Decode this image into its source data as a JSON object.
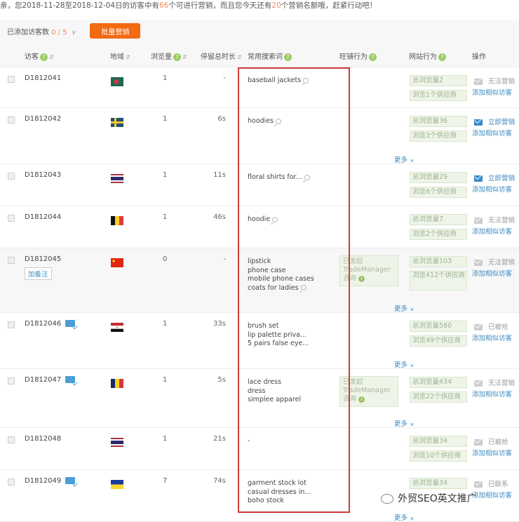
{
  "notice": {
    "prefix": "亲，您2018-11-28至2018-12-04日的访客中有",
    "visitor_count": "66",
    "middle": "个可进行营销，而且您今天还有",
    "quota": "20",
    "suffix": "个营销名额哦，赶紧行动吧！"
  },
  "toolbar": {
    "added_label": "已添加访客数",
    "added_value": "0 / 5",
    "dropdown_icon": "chevron-down-icon",
    "bulk_button": "批量营销"
  },
  "colors": {
    "accent_orange": "#f26a12",
    "link_blue": "#3a8ac4",
    "highlight_red": "#d43a3a",
    "help_green": "#9ccc65"
  },
  "table": {
    "headers": {
      "visitor": "访客",
      "region": "地域",
      "page_views": "浏览量",
      "duration": "停留总时长",
      "keywords": "常用搜索词",
      "wangpu": "旺铺行为",
      "website": "网站行为",
      "action": "操作"
    },
    "more_label": "更多",
    "add_similar": "添加相似访客",
    "remark_label": "加备注",
    "rows": [
      {
        "id": "D1812041",
        "flag": "bangladesh",
        "pv": "1",
        "dur": "-",
        "keywords": [
          "baseball jackets"
        ],
        "tm": null,
        "total_pv": "总浏览量2",
        "suppliers": "浏览1个供应商",
        "status": "无法营销",
        "active": false,
        "more": false,
        "card": false
      },
      {
        "id": "D1812042",
        "flag": "sweden",
        "pv": "1",
        "dur": "6s",
        "keywords": [
          "hoodies"
        ],
        "tm": null,
        "total_pv": "总浏览量36",
        "suppliers": "浏览3个供应商",
        "status": "立即营销",
        "active": true,
        "more": true,
        "card": false
      },
      {
        "id": "D1812043",
        "flag": "thailand",
        "pv": "1",
        "dur": "11s",
        "keywords": [
          "floral shirts for..."
        ],
        "tm": null,
        "total_pv": "总浏览量29",
        "suppliers": "浏览6个供应商",
        "status": "立即营销",
        "active": true,
        "more": false,
        "card": false
      },
      {
        "id": "D1812044",
        "flag": "belgium",
        "pv": "1",
        "dur": "46s",
        "keywords": [
          "hoodie"
        ],
        "tm": null,
        "total_pv": "总浏览量7",
        "suppliers": "浏览2个供应商",
        "status": "无法营销",
        "active": false,
        "more": false,
        "card": false
      },
      {
        "id": "D1812045",
        "flag": "china",
        "pv": "0",
        "dur": "-",
        "keywords": [
          "lipstick",
          "phone case",
          "mobile phone cases",
          "coats for ladies"
        ],
        "tm": "已发起 TradeManager 咨询",
        "total_pv": "总浏览量103",
        "suppliers": "浏览412个供应商",
        "status": "无法营销",
        "active": false,
        "more": true,
        "card": false,
        "remark": true
      },
      {
        "id": "D1812046",
        "flag": "egypt",
        "pv": "1",
        "dur": "33s",
        "keywords": [
          "brush set",
          "lip palette priva...",
          "5 pairs false eye..."
        ],
        "tm": null,
        "total_pv": "总浏览量580",
        "suppliers": "浏览49个供应商",
        "status": "已被抢",
        "active": false,
        "more": true,
        "card": true
      },
      {
        "id": "D1812047",
        "flag": "romania",
        "pv": "1",
        "dur": "5s",
        "keywords": [
          "lace dress",
          "dress",
          "simplee apparel"
        ],
        "tm": "已发起 TradeManager 咨询",
        "total_pv": "总浏览量434",
        "suppliers": "浏览22个供应商",
        "status": "无法营销",
        "active": false,
        "more": true,
        "card": true
      },
      {
        "id": "D1812048",
        "flag": "thailand",
        "pv": "1",
        "dur": "21s",
        "keywords": [
          "-"
        ],
        "tm": null,
        "total_pv": "总浏览量34",
        "suppliers": "浏览10个供应商",
        "status": "已被抢",
        "active": false,
        "more": false,
        "card": false
      },
      {
        "id": "D1812049",
        "flag": "ukraine",
        "pv": "7",
        "dur": "74s",
        "keywords": [
          "garment stock lot",
          "casual dresses in...",
          "boho stock"
        ],
        "tm": null,
        "total_pv": "总浏览量34",
        "suppliers": "",
        "status": "已联系",
        "active": false,
        "more": true,
        "card": true
      }
    ]
  },
  "watermark": "外贸SEO英文推广"
}
